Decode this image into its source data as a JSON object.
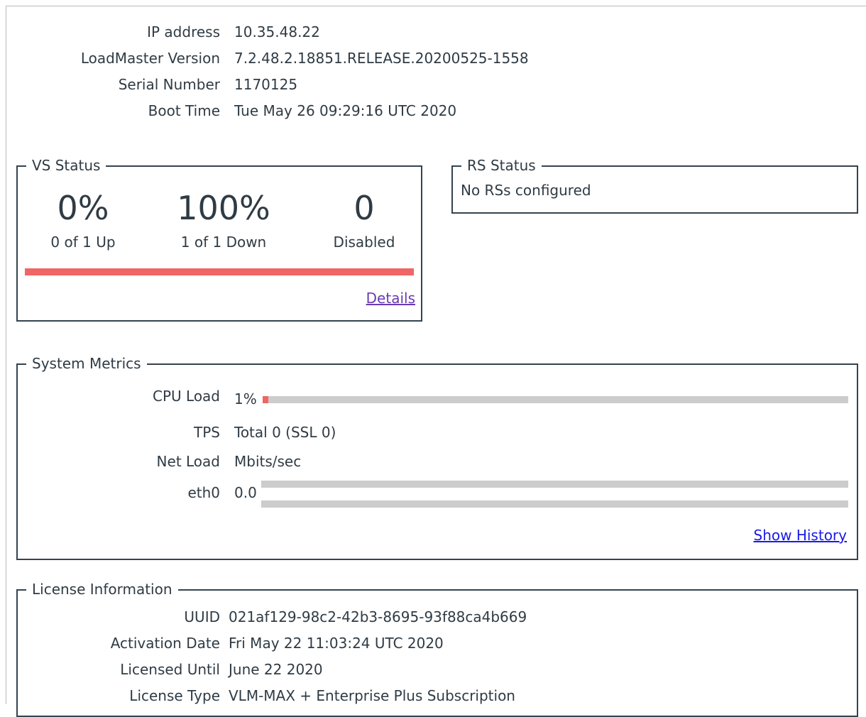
{
  "info": {
    "ip_label": "IP address",
    "ip_value": "10.35.48.22",
    "version_label": "LoadMaster Version",
    "version_value": "7.2.48.2.18851.RELEASE.20200525-1558",
    "serial_label": "Serial Number",
    "serial_value": "1170125",
    "boot_label": "Boot Time",
    "boot_value": "Tue May 26 09:29:16 UTC 2020"
  },
  "vs_status": {
    "title": "VS Status",
    "up_pct": "0%",
    "up_text": "0 of 1 Up",
    "down_pct": "100%",
    "down_text": "1 of 1 Down",
    "disabled_count": "0",
    "disabled_text": "Disabled",
    "down_fraction": 1.0,
    "details_link": "Details"
  },
  "rs_status": {
    "title": "RS Status",
    "message": "No RSs configured"
  },
  "metrics": {
    "title": "System Metrics",
    "cpu_label": "CPU Load",
    "cpu_value": "1%",
    "cpu_fraction": 0.01,
    "tps_label": "TPS",
    "tps_value": "Total 0 (SSL 0)",
    "net_label": "Net Load",
    "net_value": "Mbits/sec",
    "eth_label": "eth0",
    "eth_value": "0.0",
    "show_history": "Show History"
  },
  "license": {
    "title": "License Information",
    "uuid_label": "UUID",
    "uuid_value": "021af129-98c2-42b3-8695-93f88ca4b669",
    "activation_label": "Activation Date",
    "activation_value": "Fri May 22 11:03:24 UTC 2020",
    "until_label": "Licensed Until",
    "until_value": "June 22 2020",
    "type_label": "License Type",
    "type_value": "VLM-MAX + Enterprise Plus Subscription"
  },
  "colors": {
    "accent_red": "#f06565",
    "bar_grey": "#cccccc",
    "border": "#34434f",
    "link_visited": "#6a3ab2",
    "link": "#1a1ae6"
  }
}
